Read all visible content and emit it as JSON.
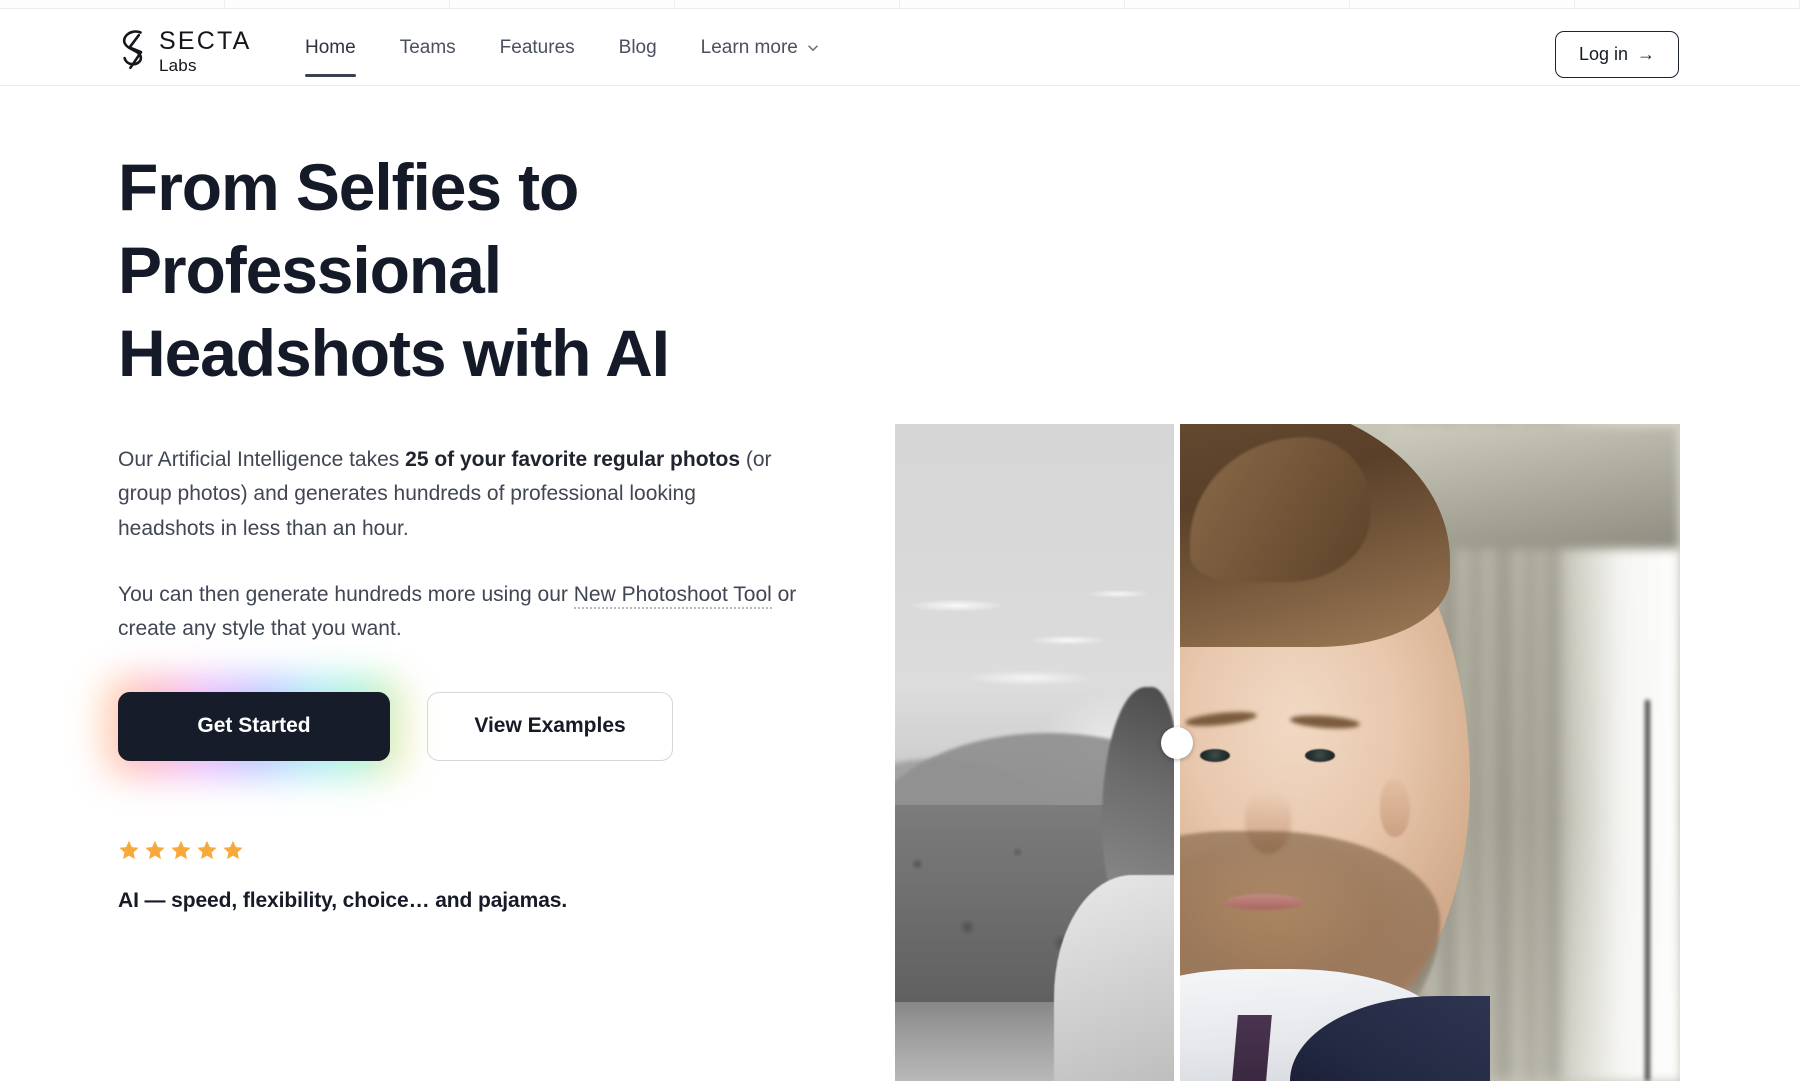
{
  "browser": {
    "tab_count": 8
  },
  "header": {
    "logo": {
      "mark": "secta-bolt-icon",
      "name": "SECTA",
      "sub": "Labs"
    },
    "nav": [
      {
        "label": "Home",
        "active": true,
        "has_chevron": false
      },
      {
        "label": "Teams",
        "active": false,
        "has_chevron": false
      },
      {
        "label": "Features",
        "active": false,
        "has_chevron": false
      },
      {
        "label": "Blog",
        "active": false,
        "has_chevron": false
      },
      {
        "label": "Learn more",
        "active": false,
        "has_chevron": true,
        "chevron_icon": "chevron-down-icon"
      }
    ],
    "login": {
      "label": "Log in",
      "arrow": "→",
      "arrow_icon": "arrow-right-icon"
    }
  },
  "hero": {
    "headline": "From Selfies to Professional Headshots with AI",
    "paragraph1": {
      "lead": "Our Artificial Intelligence takes ",
      "bold": "25 of your favorite regular photos",
      "tail": " (or group photos) and generates hundreds of professional looking headshots in less than an hour."
    },
    "paragraph2": {
      "lead": "You can then generate hundreds more using our ",
      "link": "New Photoshoot Tool",
      "tail": " or create any style that you want."
    },
    "cta": {
      "primary": "Get Started",
      "secondary": "View Examples"
    },
    "rating": {
      "stars": 5,
      "star_icon": "star-filled-icon",
      "star_color": "#F7A93B"
    },
    "tagline": "AI — speed, flexibility, choice… and pajamas."
  },
  "compare": {
    "before_alt": "grayscale-selfie-outdoors",
    "after_alt": "professional-color-headshot",
    "handle_icon": "compare-slider-handle-icon",
    "handle_position_pct": 36
  },
  "colors": {
    "ink": "#141A28",
    "body_text": "#414654",
    "nav_text": "#4B5060",
    "button_dark": "#161C29",
    "border": "#D3D6DB",
    "star": "#F7A93B"
  }
}
